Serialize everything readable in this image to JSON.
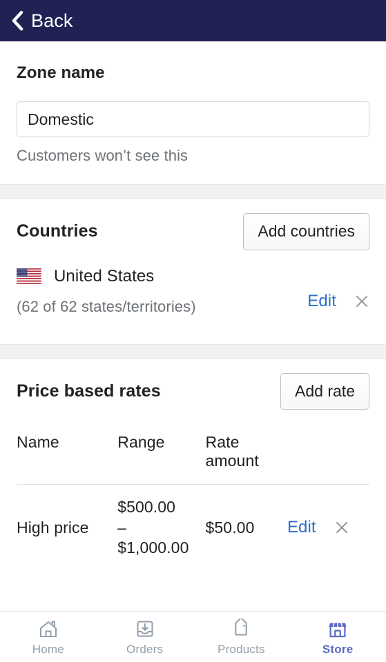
{
  "topbar": {
    "back_label": "Back",
    "back_icon": "chevron-left-icon",
    "background": "#202253"
  },
  "zone": {
    "label": "Zone name",
    "value": "Domestic",
    "placeholder": "Zone name",
    "help_text": "Customers won’t see this"
  },
  "countries": {
    "title": "Countries",
    "add_button": "Add countries",
    "rows": [
      {
        "flag_icon": "flag-us-icon",
        "name": "United States",
        "subtitle": "(62 of 62 states/territories)",
        "edit_label": "Edit",
        "remove_icon": "close-icon"
      }
    ]
  },
  "rates": {
    "title": "Price based rates",
    "add_button": "Add rate",
    "columns": [
      "Name",
      "Range",
      "Rate amount",
      ""
    ],
    "rows": [
      {
        "name": "High price",
        "range": "$500.00 – $1,000.00",
        "range_from": "$500.00",
        "range_dash": "–",
        "range_to": "$1,000.00",
        "amount": "$50.00",
        "edit_label": "Edit",
        "remove_icon": "close-icon"
      }
    ]
  },
  "bottom_nav": {
    "items": [
      {
        "label": "Home",
        "icon": "home-icon",
        "active": false
      },
      {
        "label": "Orders",
        "icon": "inbox-download-icon",
        "active": false
      },
      {
        "label": "Products",
        "icon": "tag-icon",
        "active": false
      },
      {
        "label": "Store",
        "icon": "storefront-icon",
        "active": true
      }
    ],
    "active_color": "#5c6ac4",
    "inactive_color": "#919eab"
  },
  "colors": {
    "header_navy": "#202253",
    "link_blue": "#2c6ecb",
    "text": "#202223",
    "muted": "#6d7175",
    "band": "#f1f2f4"
  }
}
